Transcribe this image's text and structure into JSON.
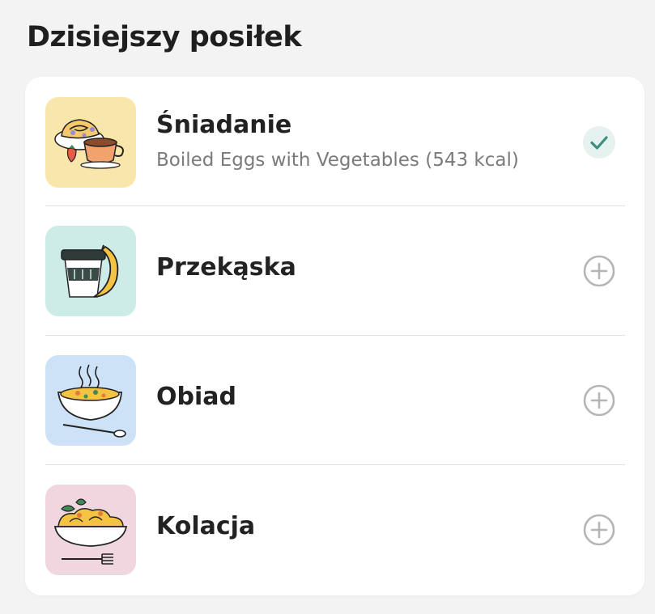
{
  "header": {
    "title": "Dzisiejszy posiłek"
  },
  "meals": [
    {
      "name": "Śniadanie",
      "detail": "Boiled Eggs with Vegetables (543 kcal)",
      "status": "logged",
      "thumb_bg": "#f9e6ab",
      "icon": "breakfast-pastry-coffee-icon"
    },
    {
      "name": "Przekąska",
      "status": "add",
      "thumb_bg": "#cdebe7",
      "icon": "snack-cup-banana-icon"
    },
    {
      "name": "Obiad",
      "status": "add",
      "thumb_bg": "#cde2f6",
      "icon": "lunch-soup-bowl-icon"
    },
    {
      "name": "Kolacja",
      "status": "add",
      "thumb_bg": "#f0d6df",
      "icon": "dinner-pasta-bowl-icon"
    }
  ],
  "colors": {
    "check_accent": "#3a8f7f",
    "check_bg": "#e6f2ef",
    "add_icon": "#b5b5b5"
  }
}
